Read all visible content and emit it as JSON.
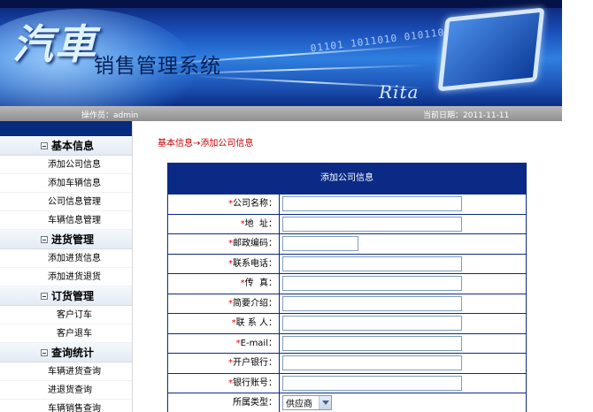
{
  "banner": {
    "logo_text": "汽車",
    "title": "销售管理系统",
    "brand": "Rita"
  },
  "status": {
    "operator": "操作员：admin",
    "date": "当前日期：2011-11-11"
  },
  "sidebar": {
    "groups": [
      {
        "title": "基本信息",
        "items": [
          "添加公司信息",
          "添加车辆信息",
          "公司信息管理",
          "车辆信息管理"
        ]
      },
      {
        "title": "进货管理",
        "items": [
          "添加进货信息",
          "添加进货退货"
        ]
      },
      {
        "title": "订货管理",
        "items": [
          "客户订车",
          "客户退车"
        ]
      },
      {
        "title": "查询统计",
        "items": [
          "车辆进货查询",
          "进退货查询",
          "车辆销售查询"
        ]
      }
    ]
  },
  "breadcrumb": "基本信息→添加公司信息",
  "form": {
    "title": "添加公司信息",
    "fields": [
      {
        "label": "公司名称：",
        "required": "*",
        "value": ""
      },
      {
        "label": "地  址：",
        "required": "*",
        "value": ""
      },
      {
        "label": "邮政编码：",
        "required": "*",
        "value": ""
      },
      {
        "label": "联系电话：",
        "required": "*",
        "value": ""
      },
      {
        "label": "传  真：",
        "required": "*",
        "value": ""
      },
      {
        "label": "简要介绍：",
        "required": "*",
        "value": ""
      },
      {
        "label": "联 系 人：",
        "required": "*",
        "value": ""
      },
      {
        "label": "E-mail：",
        "required": "*",
        "value": ""
      },
      {
        "label": "开户银行：",
        "required": "*",
        "value": ""
      },
      {
        "label": "银行账号：",
        "required": "*",
        "value": ""
      }
    ],
    "type_label": "所属类型：",
    "type_value": "供应商"
  },
  "colors": {
    "header_blue": "#0b2a86",
    "breadcrumb_red": "#c00000",
    "required_red": "#e00000"
  }
}
